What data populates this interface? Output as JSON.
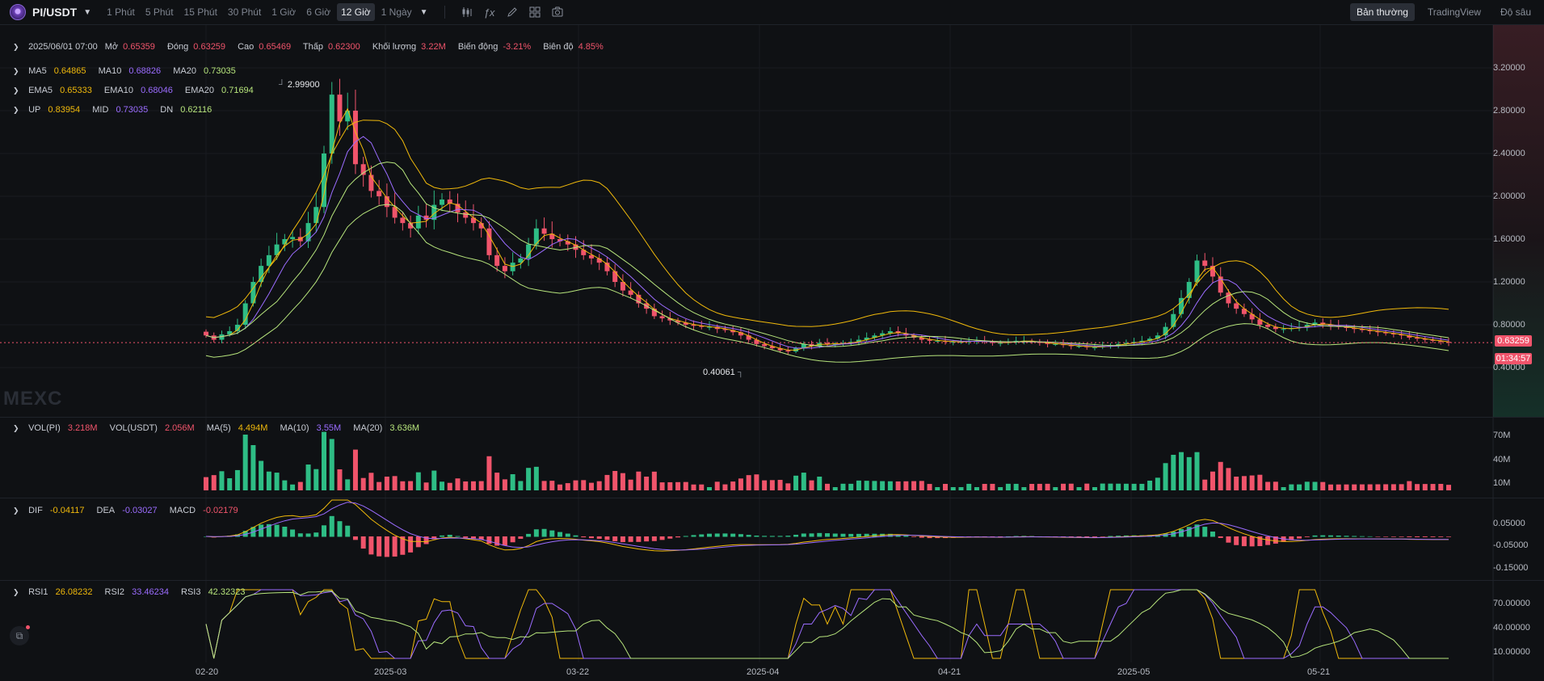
{
  "pair": "PI/USDT",
  "timeframes": [
    "1 Phút",
    "5 Phút",
    "15 Phút",
    "30 Phút",
    "1 Giờ",
    "6 Giờ",
    "12 Giờ",
    "1 Ngày"
  ],
  "active_timeframe": "12 Giờ",
  "tools": [
    "candle-type-icon",
    "indicator-fx-icon",
    "draw-pencil-icon",
    "layout-grid-icon",
    "camera-icon"
  ],
  "view_tabs": [
    "Bản thường",
    "TradingView",
    "Độ sâu"
  ],
  "active_view": "Bản thường",
  "ohlc": {
    "date": "2025/06/01 07:00",
    "open_label": "Mở",
    "open": "0.65359",
    "close_label": "Đóng",
    "close": "0.63259",
    "high_label": "Cao",
    "high": "0.65469",
    "low_label": "Thấp",
    "low": "0.62300",
    "volume_label": "Khối lượng",
    "volume": "3.22M",
    "change_label": "Biến động",
    "change": "-3.21%",
    "amplitude_label": "Biên độ",
    "amplitude": "4.85%"
  },
  "ma": {
    "ma5_label": "MA5",
    "ma5": "0.64865",
    "ma10_label": "MA10",
    "ma10": "0.68826",
    "ma20_label": "MA20",
    "ma20": "0.73035"
  },
  "ema": {
    "ema5_label": "EMA5",
    "ema5": "0.65333",
    "ema10_label": "EMA10",
    "ema10": "0.68046",
    "ema20_label": "EMA20",
    "ema20": "0.71694"
  },
  "boll": {
    "up_label": "UP",
    "up": "0.83954",
    "mid_label": "MID",
    "mid": "0.73035",
    "dn_label": "DN",
    "dn": "0.62116"
  },
  "price_axis": [
    "3.20000",
    "2.80000",
    "2.40000",
    "2.00000",
    "1.60000",
    "1.20000",
    "0.80000",
    "0.40000"
  ],
  "high_marker": "2.99900",
  "low_marker": "0.40061",
  "current_price": "0.63259",
  "countdown": "01:34:57",
  "watermark": "MEXC",
  "vol": {
    "pi_label": "VOL(PI)",
    "pi": "3.218M",
    "usdt_label": "VOL(USDT)",
    "usdt": "2.056M",
    "ma5_label": "MA(5)",
    "ma5": "4.494M",
    "ma10_label": "MA(10)",
    "ma10": "3.55M",
    "ma20_label": "MA(20)",
    "ma20": "3.636M"
  },
  "vol_axis": [
    "70M",
    "40M",
    "10M"
  ],
  "macd": {
    "dif_label": "DIF",
    "dif": "-0.04117",
    "dea_label": "DEA",
    "dea": "-0.03027",
    "macd_label": "MACD",
    "macd": "-0.02179"
  },
  "macd_axis": [
    "0.05000",
    "-0.05000",
    "-0.15000"
  ],
  "rsi": {
    "rsi1_label": "RSI1",
    "rsi1": "26.08232",
    "rsi2_label": "RSI2",
    "rsi2": "33.46234",
    "rsi3_label": "RSI3",
    "rsi3": "42.32323"
  },
  "rsi_axis": [
    "70.00000",
    "40.00000",
    "10.00000"
  ],
  "x_axis": [
    "02-20",
    "2025-03",
    "03-22",
    "2025-04",
    "04-21",
    "2025-05",
    "05-21"
  ],
  "colors": {
    "up": "#2ebd85",
    "down": "#f0546b",
    "ma5": "#f0b90b",
    "ma10": "#9b6cff",
    "ma20": "#b7e57c",
    "bg": "#0f1114"
  },
  "chart_data": {
    "type": "candlestick",
    "series_close": [
      0.7,
      0.66,
      0.71,
      0.74,
      0.8,
      1.0,
      1.2,
      1.35,
      1.45,
      1.55,
      1.6,
      1.62,
      1.58,
      1.75,
      1.9,
      2.4,
      2.95,
      2.7,
      2.8,
      2.3,
      2.2,
      2.05,
      2.0,
      1.9,
      1.8,
      1.75,
      1.7,
      1.82,
      1.78,
      1.92,
      1.97,
      1.93,
      1.85,
      1.8,
      1.75,
      1.7,
      1.45,
      1.35,
      1.3,
      1.38,
      1.42,
      1.55,
      1.7,
      1.65,
      1.6,
      1.58,
      1.55,
      1.5,
      1.45,
      1.42,
      1.38,
      1.3,
      1.2,
      1.12,
      1.08,
      1.0,
      0.95,
      0.88,
      0.86,
      0.84,
      0.82,
      0.8,
      0.79,
      0.78,
      0.78,
      0.76,
      0.75,
      0.73,
      0.7,
      0.66,
      0.62,
      0.6,
      0.58,
      0.56,
      0.55,
      0.58,
      0.62,
      0.6,
      0.63,
      0.62,
      0.62,
      0.63,
      0.64,
      0.66,
      0.68,
      0.7,
      0.72,
      0.74,
      0.72,
      0.7,
      0.68,
      0.66,
      0.65,
      0.65,
      0.64,
      0.64,
      0.64,
      0.65,
      0.65,
      0.64,
      0.63,
      0.63,
      0.64,
      0.65,
      0.65,
      0.64,
      0.63,
      0.62,
      0.62,
      0.61,
      0.6,
      0.6,
      0.59,
      0.59,
      0.6,
      0.61,
      0.62,
      0.63,
      0.64,
      0.65,
      0.67,
      0.7,
      0.78,
      0.9,
      1.05,
      1.2,
      1.4,
      1.35,
      1.25,
      1.1,
      1.0,
      0.95,
      0.9,
      0.85,
      0.8,
      0.78,
      0.76,
      0.76,
      0.77,
      0.78,
      0.8,
      0.82,
      0.8,
      0.79,
      0.78,
      0.77,
      0.76,
      0.75,
      0.74,
      0.73,
      0.72,
      0.71,
      0.7,
      0.68,
      0.67,
      0.66,
      0.65,
      0.64,
      0.633
    ]
  }
}
